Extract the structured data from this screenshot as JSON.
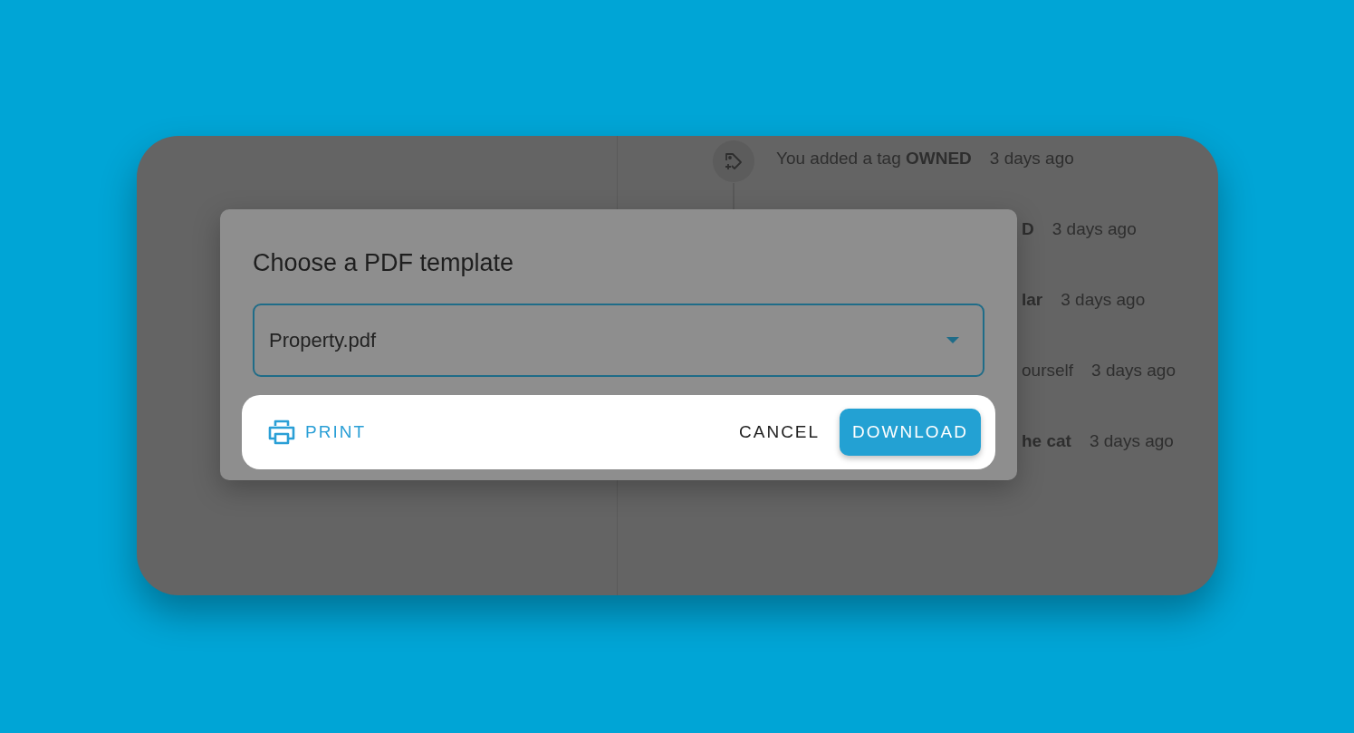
{
  "activity": [
    {
      "text": "You added a tag **OWNED**",
      "time": "3 days ago",
      "kind": "tag"
    },
    {
      "text": "**D**",
      "time": "3 days ago"
    },
    {
      "text": "**lar**",
      "time": "3 days ago"
    },
    {
      "text": "ourself",
      "time": "3 days ago"
    },
    {
      "text": "**he cat**",
      "time": "3 days ago"
    }
  ],
  "dialog": {
    "title": "Choose a PDF template",
    "select": {
      "value": "Property.pdf"
    },
    "actions": [
      {
        "label": "PRINT",
        "kind": "print"
      },
      {
        "label": "CANCEL",
        "kind": "text"
      },
      {
        "label": "DOWNLOAD",
        "kind": "primary"
      }
    ]
  }
}
